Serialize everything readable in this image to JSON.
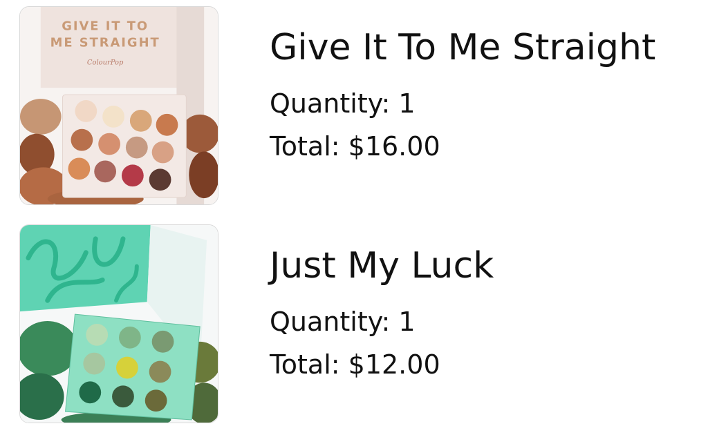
{
  "cart": {
    "items": [
      {
        "image_alt": "Give It To Me Straight eyeshadow palette",
        "box_text": "GIVE IT TO ME STRAIGHT",
        "brand": "ColourPop",
        "name": "Give It To Me Straight",
        "quantity_label": "Quantity:",
        "quantity": "1",
        "total_label": "Total:",
        "total": "$16.00"
      },
      {
        "image_alt": "Just My Luck eyeshadow palette",
        "box_text": "Just My Luck",
        "name": "Just My Luck",
        "quantity_label": "Quantity:",
        "quantity": "1",
        "total_label": "Total:",
        "total": "$12.00"
      }
    ]
  },
  "colors": {
    "text": "#111111",
    "thumb_border": "#d9d9d9",
    "palette1_box": "#efe3de",
    "palette1_text": "#c99a76",
    "palette2_box": "#5fd3b3",
    "palette2_text": "#2fb58e"
  }
}
